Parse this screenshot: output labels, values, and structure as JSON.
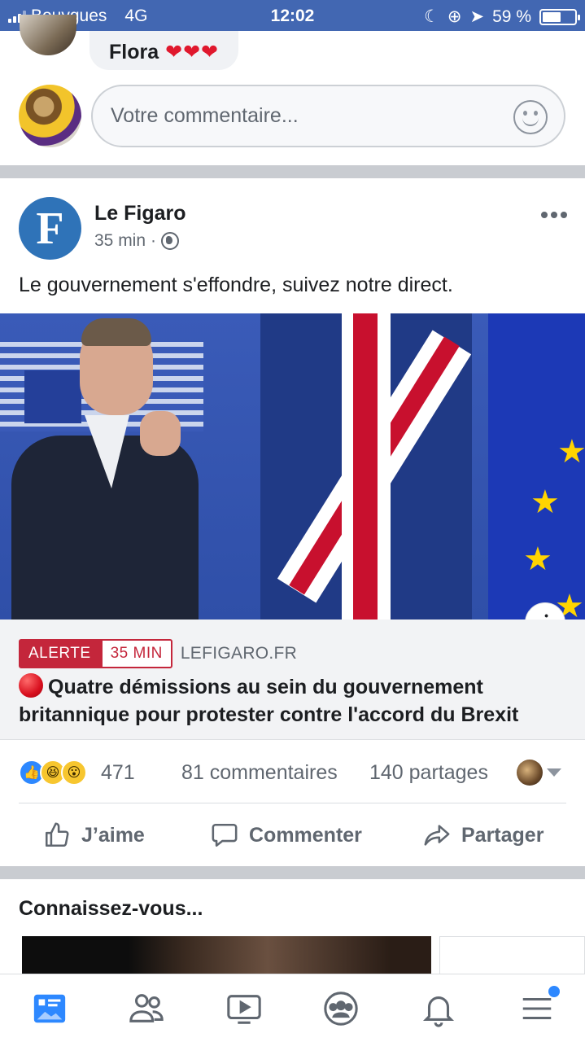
{
  "status_bar": {
    "carrier": "Bouygues",
    "network": "4G",
    "time": "12:02",
    "battery": "59 %",
    "battery_level": 0.59
  },
  "previous_comment": {
    "author": "Flora",
    "hearts": "❤❤❤"
  },
  "comment_composer": {
    "placeholder": "Votre commentaire..."
  },
  "post": {
    "page_name": "Le Figaro",
    "page_logo_letter": "F",
    "time": "35 min",
    "separator": "·",
    "text": "Le gouvernement s'effondre, suivez notre direct.",
    "info_icon_glyph": "i",
    "link": {
      "tag_alert": "ALERTE",
      "tag_time": "35 MIN",
      "domain": "LEFIGARO.FR",
      "title": "Quatre démissions au sein du gouvernement britannique pour protester contre l'accord du Brexit"
    },
    "stats": {
      "reactions": [
        "like",
        "haha",
        "wow"
      ],
      "reaction_count": "471",
      "comments": "81 commentaires",
      "shares": "140 partages"
    },
    "actions": {
      "like": "J’aime",
      "comment": "Commenter",
      "share": "Partager"
    }
  },
  "suggestions": {
    "title": "Connaissez-vous..."
  },
  "bottom_nav": {
    "items": [
      "news-feed-icon",
      "friends-icon",
      "watch-icon",
      "groups-icon",
      "notifications-icon",
      "menu-icon"
    ],
    "active": "news-feed-icon",
    "accent": "#2d88ff"
  },
  "colors": {
    "brand": "#4267b2",
    "alert_red": "#c4263b",
    "text_secondary": "#606770"
  }
}
